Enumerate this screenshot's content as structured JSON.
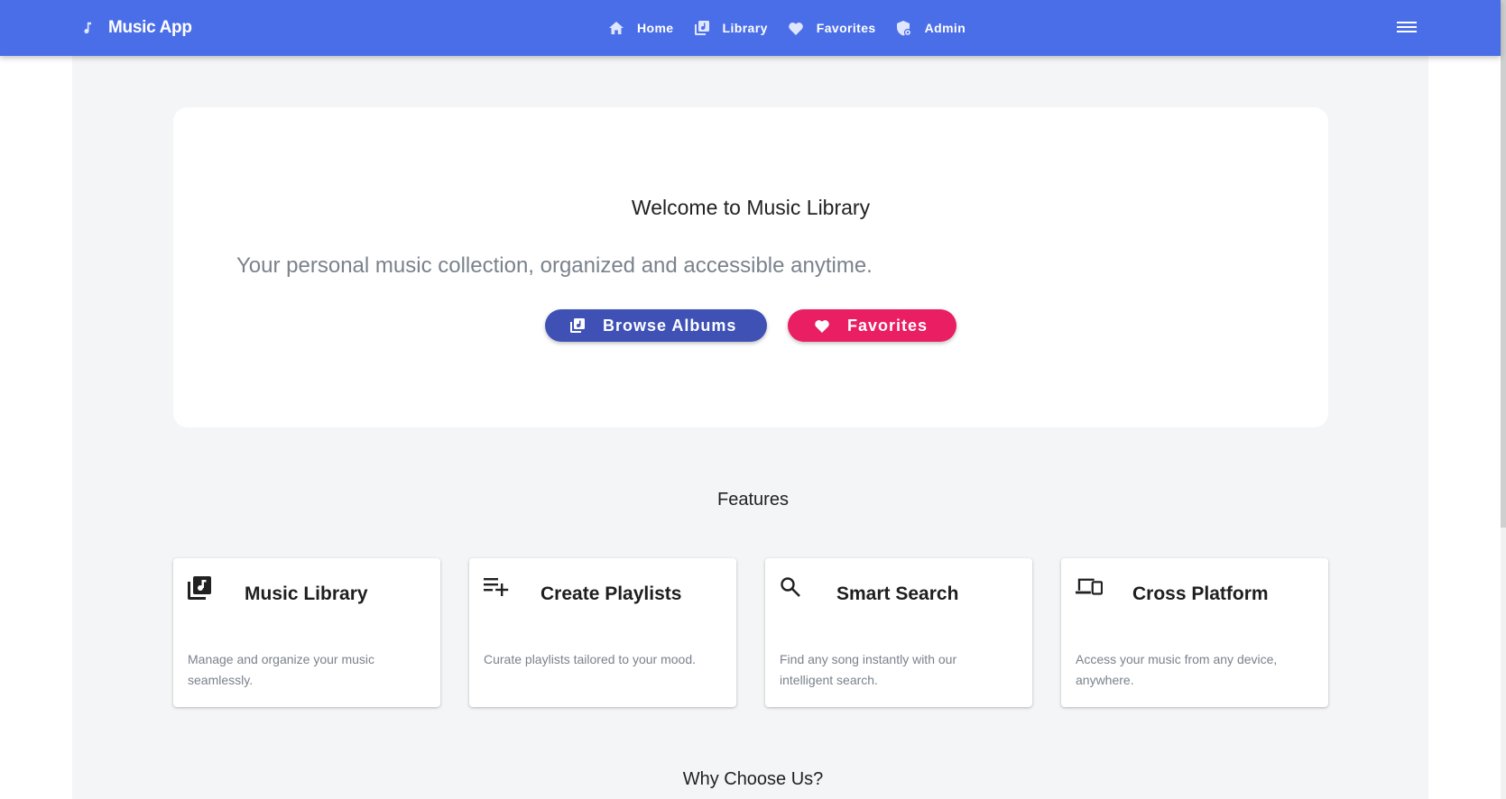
{
  "navbar": {
    "brand_icon": "music-note-icon",
    "brand_title": "Music App",
    "links": [
      {
        "label": "Home",
        "icon": "home-icon"
      },
      {
        "label": "Library",
        "icon": "library-music-icon"
      },
      {
        "label": "Favorites",
        "icon": "heart-icon"
      },
      {
        "label": "Admin",
        "icon": "admin-shield-icon"
      }
    ],
    "menu_icon": "hamburger-menu-icon"
  },
  "hero": {
    "title": "Welcome to Music Library",
    "subtitle": "Your personal music collection, organized and accessible anytime.",
    "primary_button": {
      "label": "Browse Albums",
      "icon": "library-music-icon",
      "color": "#3f51b5"
    },
    "secondary_button": {
      "label": "Favorites",
      "icon": "heart-icon",
      "color": "#e91e63"
    }
  },
  "features": {
    "title": "Features",
    "cards": [
      {
        "title": "Music Library",
        "description": "Manage and organize your music seamlessly.",
        "icon": "library-music-icon"
      },
      {
        "title": "Create Playlists",
        "description": "Curate playlists tailored to your mood.",
        "icon": "playlist-add-icon"
      },
      {
        "title": "Smart Search",
        "description": "Find any song instantly with our intelligent search.",
        "icon": "search-icon"
      },
      {
        "title": "Cross Platform",
        "description": "Access your music from any device, anywhere.",
        "icon": "devices-icon"
      }
    ]
  },
  "why": {
    "title": "Why Choose Us?"
  },
  "colors": {
    "navbar": "#4a6ee8",
    "primary": "#3f51b5",
    "accent": "#e91e63",
    "page_background": "#f4f5f7"
  }
}
